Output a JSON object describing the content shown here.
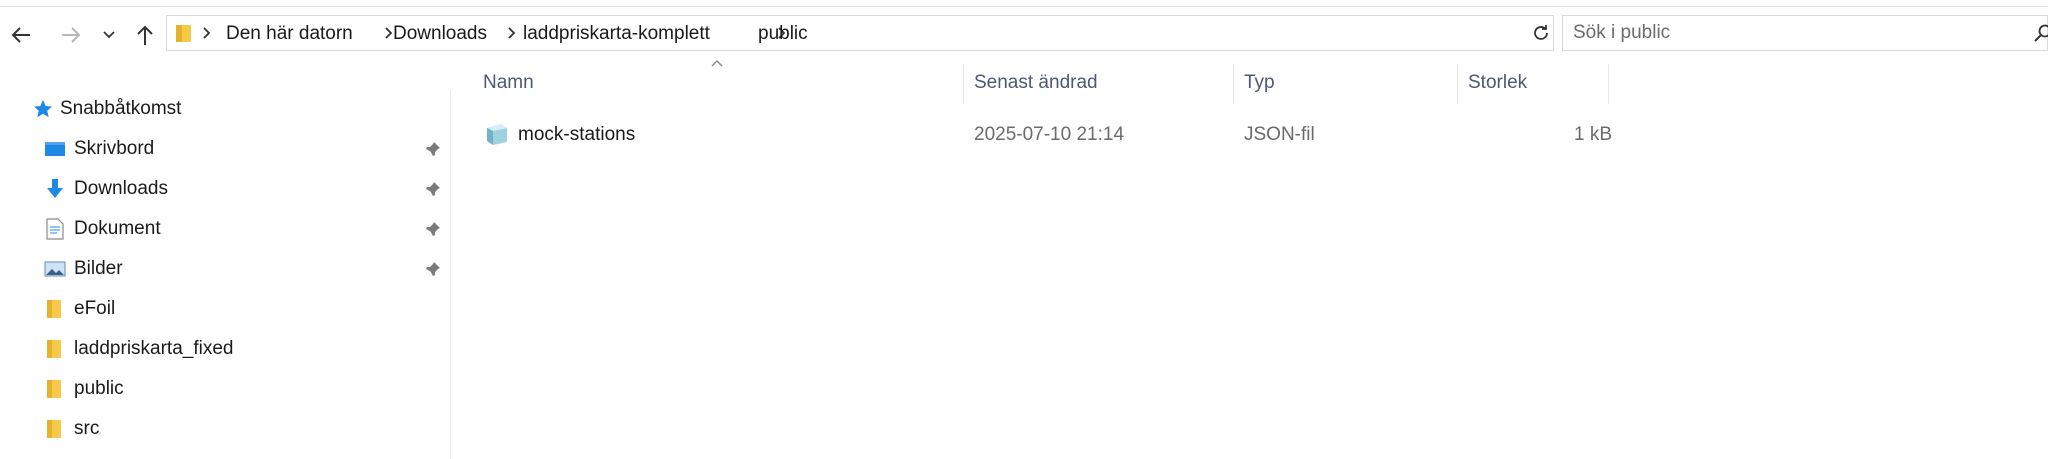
{
  "nav": {
    "back_icon": "arrow-left-icon",
    "forward_icon": "arrow-right-icon",
    "recent_icon": "chevron-down-icon",
    "up_icon": "arrow-up-icon"
  },
  "address": {
    "crumbs": [
      "Den här datorn",
      "Downloads",
      "laddpriskarta-komplett",
      "public"
    ]
  },
  "search": {
    "placeholder": "Sök i public"
  },
  "sidebar": {
    "quick_access": "Snabbåtkomst",
    "items": [
      {
        "label": "Skrivbord",
        "icon": "desktop-icon",
        "pinned": true
      },
      {
        "label": "Downloads",
        "icon": "download-arrow-icon",
        "pinned": true
      },
      {
        "label": "Dokument",
        "icon": "document-icon",
        "pinned": true
      },
      {
        "label": "Bilder",
        "icon": "pictures-icon",
        "pinned": true
      },
      {
        "label": "eFoil",
        "icon": "folder-icon",
        "pinned": false
      },
      {
        "label": "laddpriskarta_fixed",
        "icon": "folder-icon",
        "pinned": false
      },
      {
        "label": "public",
        "icon": "folder-icon",
        "pinned": false
      },
      {
        "label": "src",
        "icon": "folder-icon",
        "pinned": false
      }
    ]
  },
  "columns": {
    "name": "Namn",
    "date": "Senast ändrad",
    "type": "Typ",
    "size": "Storlek"
  },
  "files": [
    {
      "name": "mock-stations",
      "date": "2025-07-10 21:14",
      "type": "JSON-fil",
      "size": "1 kB"
    }
  ],
  "colors": {
    "folder": "#f7c948",
    "accent": "#1e88e5",
    "header_text": "#4b5a73"
  }
}
